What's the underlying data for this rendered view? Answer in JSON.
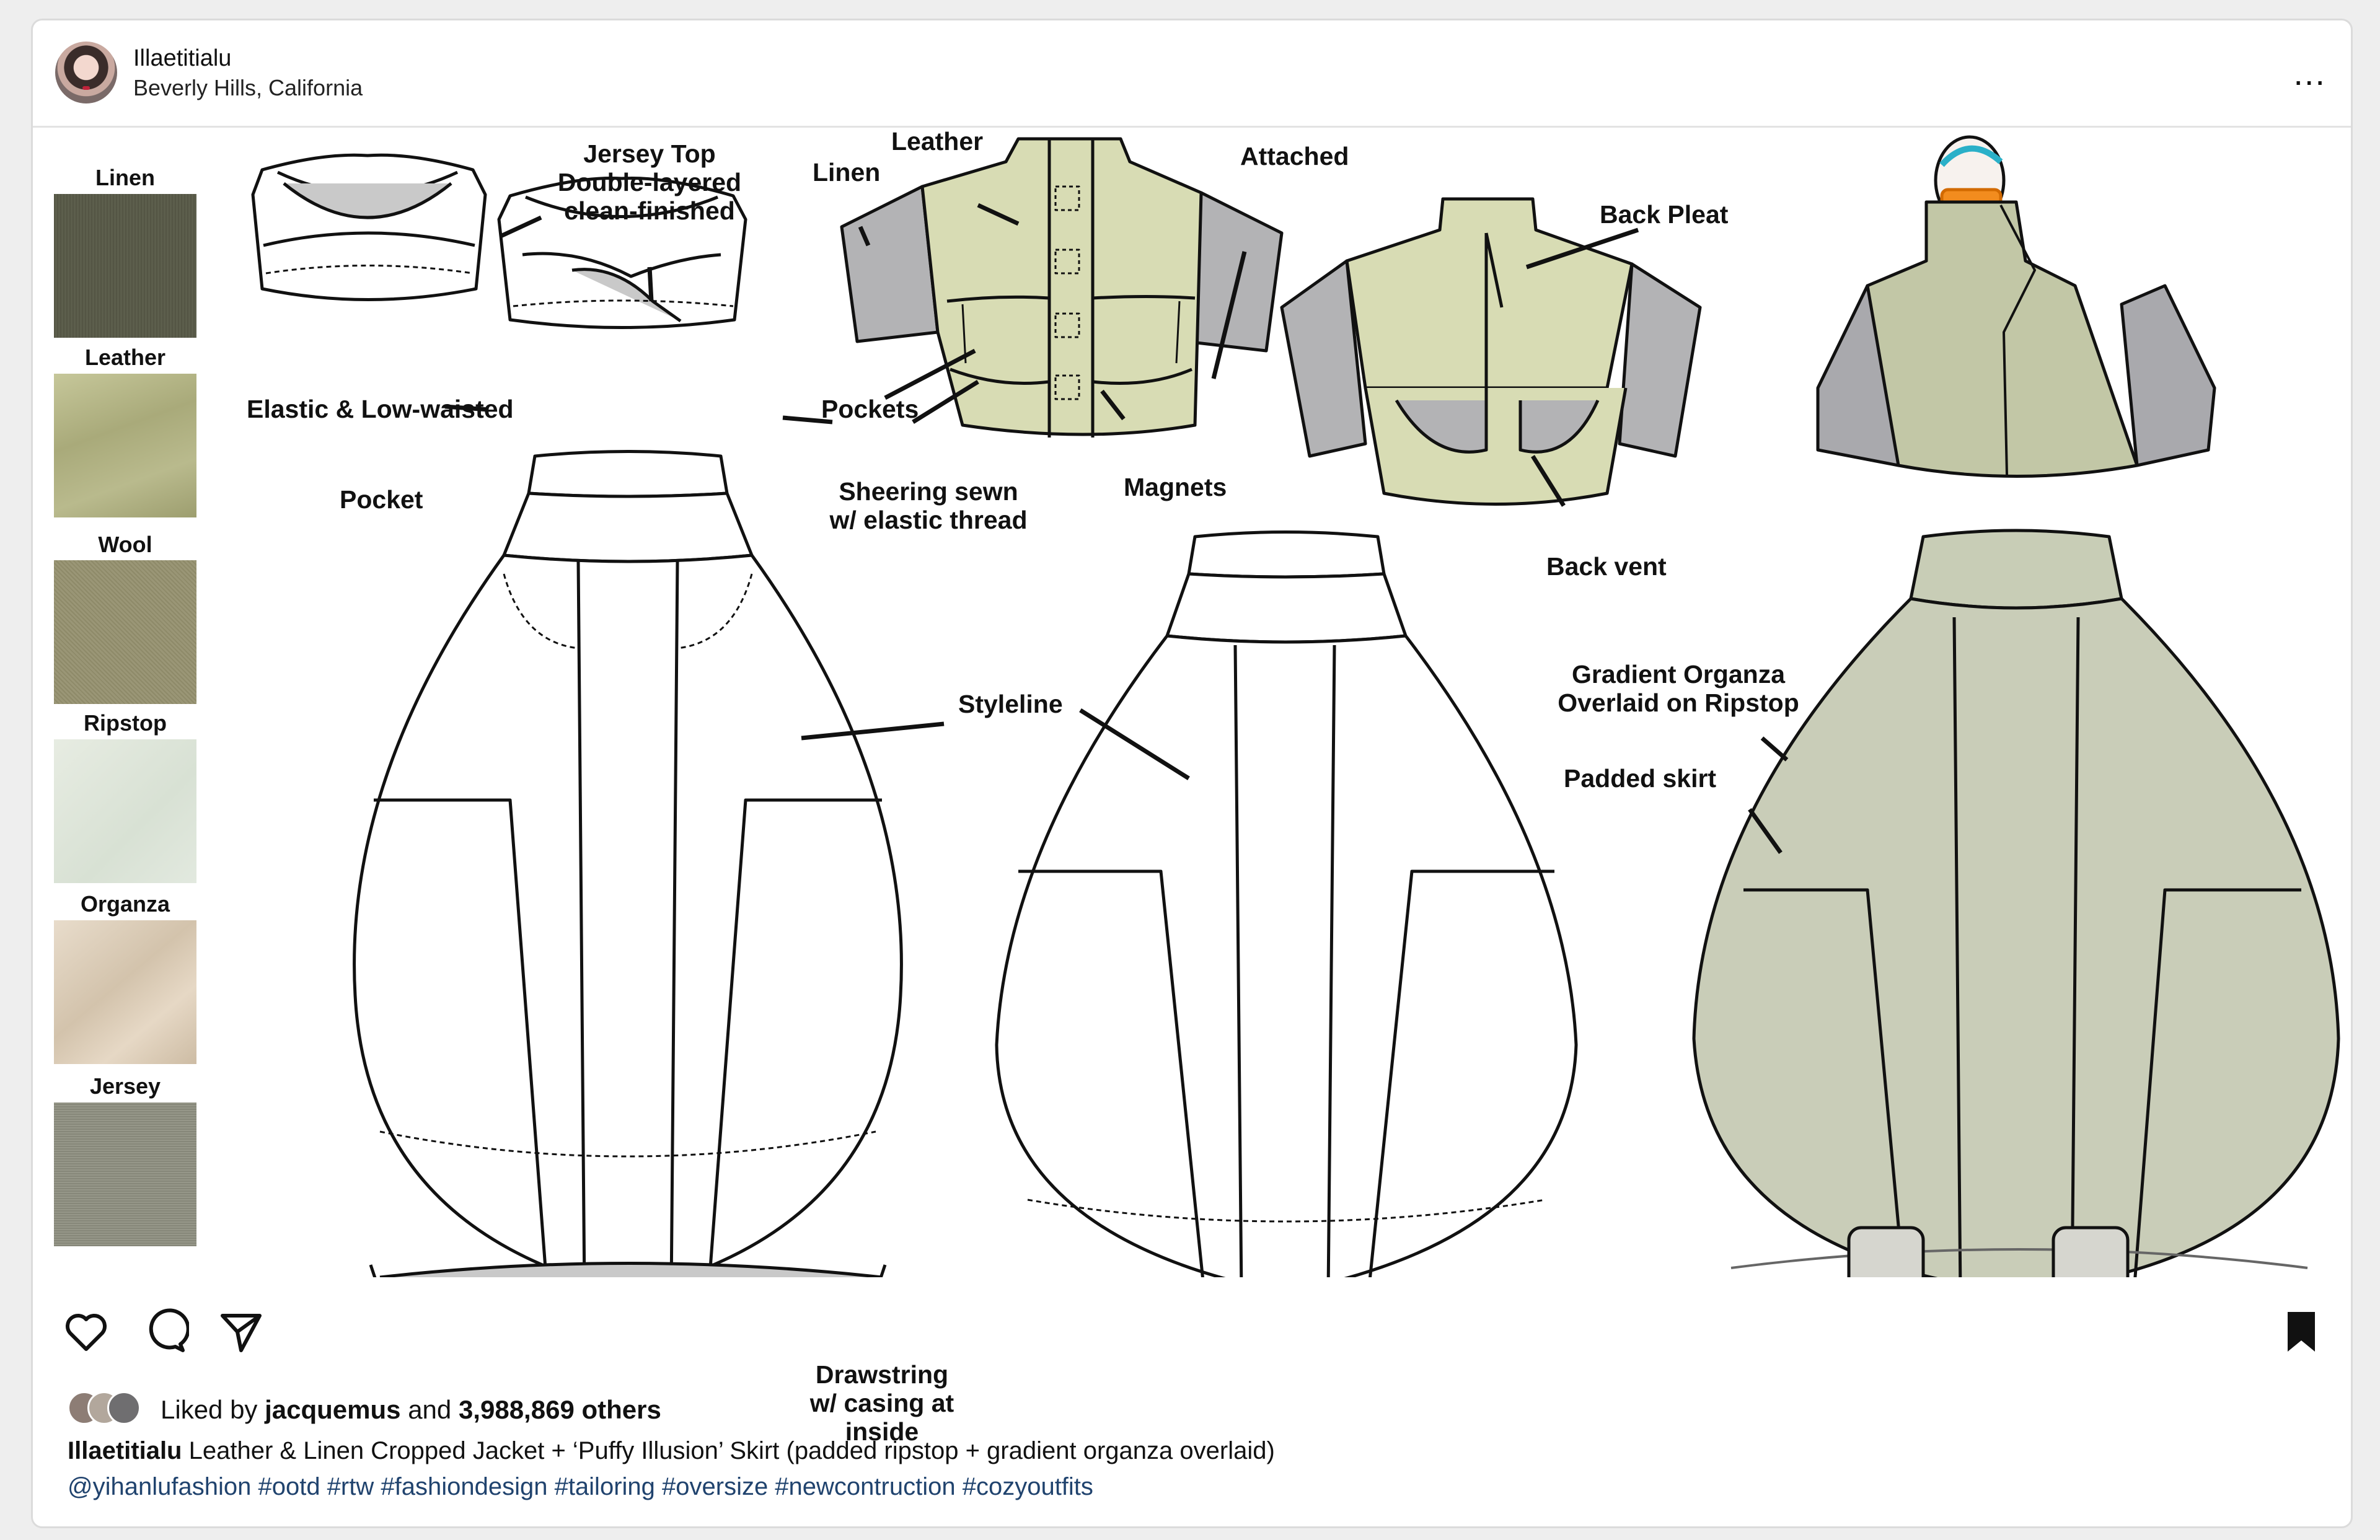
{
  "header": {
    "username": "Illaetitialu",
    "location": "Beverly Hills, California",
    "more_label": "..."
  },
  "materials": [
    {
      "label": "Linen"
    },
    {
      "label": "Leather"
    },
    {
      "label": "Wool"
    },
    {
      "label": "Ripstop"
    },
    {
      "label": "Organza"
    },
    {
      "label": "Jersey"
    }
  ],
  "annotations": {
    "jersey_top": "Jersey Top\nDouble-layered\nclean-finished",
    "elastic": "Elastic & Low-waisted",
    "pocket": "Pocket",
    "sheering": "Sheering sewn\nw/ elastic thread",
    "leather": "Leather",
    "linen": "Linen",
    "attached": "Attached",
    "pockets": "Pockets",
    "magnets": "Magnets",
    "back_pleat": "Back Pleat",
    "back_vent": "Back vent",
    "styleline": "Styleline",
    "drawstring": "Drawstring\nw/ casing at inside",
    "gradient_organza": "Gradient Organza\nOverlaid on Ripstop",
    "padded_skirt": "Padded skirt"
  },
  "actions": {
    "like_icon": "heart-icon",
    "comment_icon": "comment-icon",
    "share_icon": "send-icon",
    "save_icon": "bookmark-icon"
  },
  "likes": {
    "prefix": "Liked by",
    "user": "jacquemus",
    "middle": "and",
    "count": "3,988,869 others"
  },
  "caption": {
    "user": "Illaetitialu",
    "text": "Leather & Linen Cropped Jacket + ‘Puffy Illusion’ Skirt (padded ripstop + gradient organza overlaid)"
  },
  "hashtags": "@yihanlufashion #ootd #rtw #fashiondesign #tailoring #oversize #newcontruction #cozyoutfits",
  "colors": {
    "leather": "#d8dcb4",
    "linen": "#b3b3b5",
    "skirt_render": "#c9cdb8",
    "link": "#20436e"
  }
}
